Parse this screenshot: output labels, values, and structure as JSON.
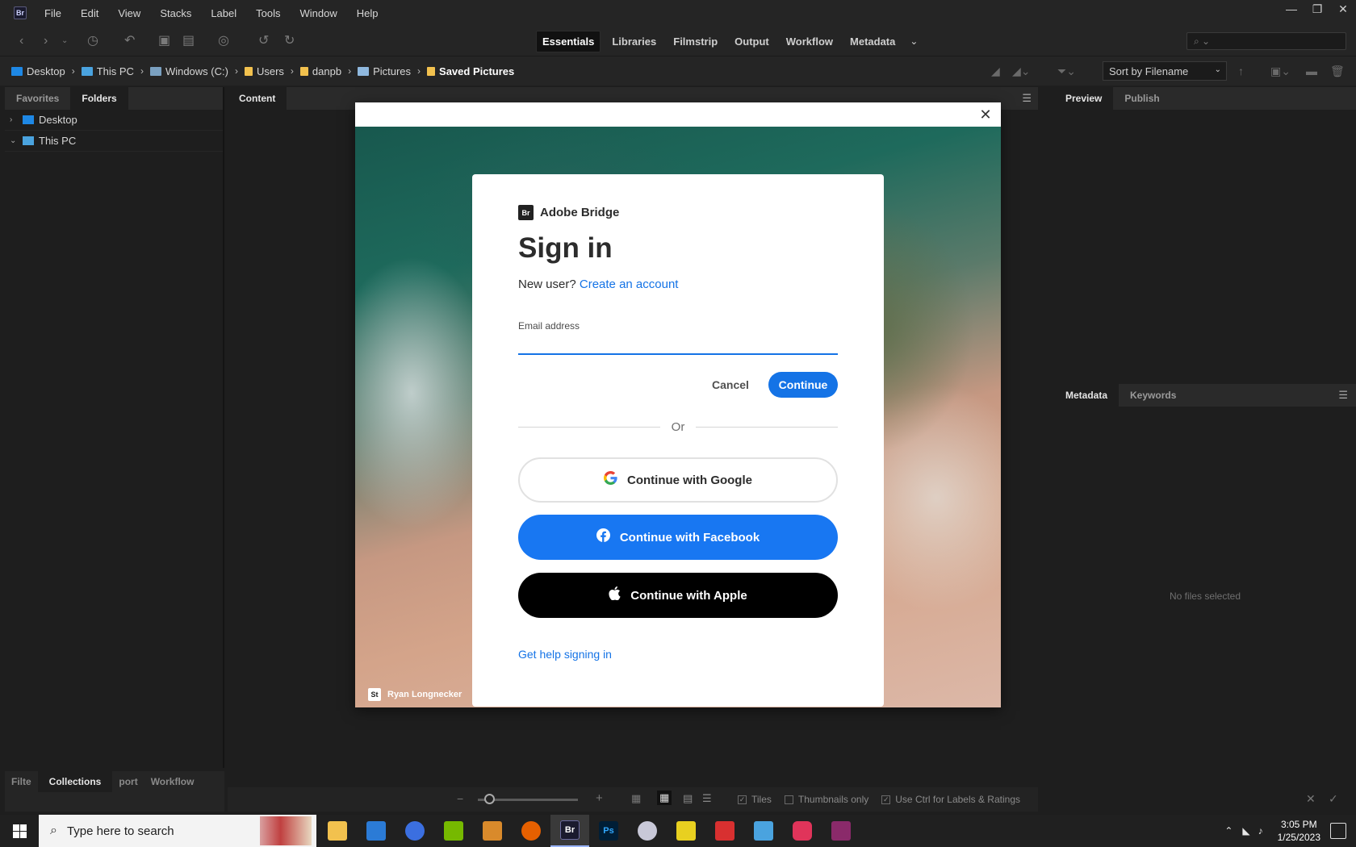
{
  "menubar": {
    "logo": "Br",
    "items": [
      "File",
      "Edit",
      "View",
      "Stacks",
      "Label",
      "Tools",
      "Window",
      "Help"
    ]
  },
  "toolbar": {
    "workspaces": [
      "Essentials",
      "Libraries",
      "Filmstrip",
      "Output",
      "Workflow",
      "Metadata"
    ],
    "active_workspace": "Essentials"
  },
  "pathbar": {
    "crumbs": [
      "Desktop",
      "This PC",
      "Windows (C:)",
      "Users",
      "danpb",
      "Pictures",
      "Saved Pictures"
    ],
    "sort_label": "Sort by Filename"
  },
  "left_panel": {
    "tabs": [
      "Favorites",
      "Folders"
    ],
    "active_tab": "Folders",
    "tree": [
      "Desktop",
      "This PC"
    ],
    "bottom_tabs": [
      "Filte",
      "Collections",
      "port",
      "Workflow"
    ]
  },
  "content_panel": {
    "tab": "Content",
    "options": [
      "Tiles",
      "Thumbnails only",
      "Use Ctrl for Labels & Ratings"
    ]
  },
  "right_panel": {
    "top_tabs": [
      "Preview",
      "Publish"
    ],
    "bottom_tabs": [
      "Metadata",
      "Keywords"
    ],
    "empty_text": "No files selected"
  },
  "dialog": {
    "photo_credit": "Ryan Longnecker",
    "credit_badge": "St",
    "brand_logo": "Br",
    "brand_name": "Adobe Bridge",
    "title": "Sign in",
    "new_user_text": "New user?",
    "create_account": "Create an account",
    "email_label": "Email address",
    "email_value": "",
    "cancel": "Cancel",
    "continue": "Continue",
    "or": "Or",
    "google": "Continue with Google",
    "facebook": "Continue with Facebook",
    "apple": "Continue with Apple",
    "help": "Get help signing in"
  },
  "taskbar": {
    "search_placeholder": "Type here to search",
    "time": "3:05 PM",
    "date": "1/25/2023"
  }
}
